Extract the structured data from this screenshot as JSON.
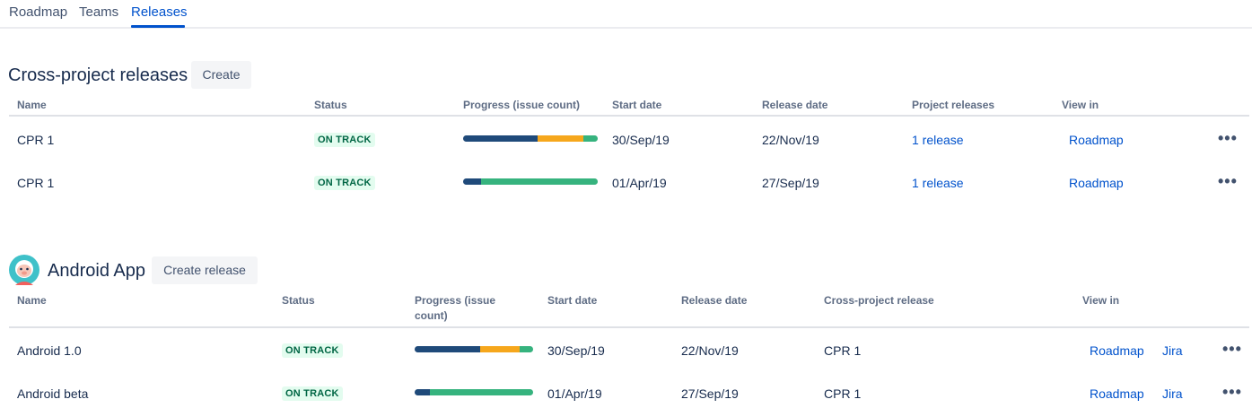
{
  "tabs": [
    {
      "label": "Roadmap",
      "active": false
    },
    {
      "label": "Teams",
      "active": false
    },
    {
      "label": "Releases",
      "active": true
    }
  ],
  "colors": {
    "done": "#1F4A7A",
    "in_progress": "#F6A71C",
    "todo": "#36B37E",
    "link": "#0052CC",
    "lozenge_bg": "#E3FCEF",
    "lozenge_text": "#006644"
  },
  "cross_project": {
    "title": "Cross-project releases",
    "create_label": "Create",
    "columns": {
      "name": "Name",
      "status": "Status",
      "progress": "Progress (issue count)",
      "start_date": "Start date",
      "release_date": "Release date",
      "project_releases": "Project releases",
      "view_in": "View in"
    },
    "rows": [
      {
        "name": "CPR 1",
        "status": "ON TRACK",
        "progress": {
          "done": 0.55,
          "in_progress": 0.34,
          "todo": 0.11
        },
        "start_date": "30/Sep/19",
        "release_date": "22/Nov/19",
        "project_releases": "1 release",
        "view_in": "Roadmap",
        "more_icon": "more-horizontal-icon"
      },
      {
        "name": "CPR 1",
        "status": "ON TRACK",
        "progress": {
          "done": 0.13,
          "in_progress": 0,
          "todo": 0.87
        },
        "start_date": "01/Apr/19",
        "release_date": "27/Sep/19",
        "project_releases": "1 release",
        "view_in": "Roadmap",
        "more_icon": "more-horizontal-icon"
      }
    ]
  },
  "android": {
    "title": "Android App",
    "avatar_icon": "project-avatar-icon",
    "create_label": "Create release",
    "columns": {
      "name": "Name",
      "status": "Status",
      "progress_line1": "Progress (issue",
      "progress_line2": "count)",
      "start_date": "Start date",
      "release_date": "Release date",
      "cross_project_release": "Cross-project release",
      "view_in": "View in"
    },
    "rows": [
      {
        "name": "Android 1.0",
        "status": "ON TRACK",
        "progress": {
          "done": 0.55,
          "in_progress": 0.34,
          "todo": 0.11
        },
        "start_date": "30/Sep/19",
        "release_date": "22/Nov/19",
        "cross_project_release": "CPR 1",
        "view_roadmap": "Roadmap",
        "view_jira": "Jira",
        "more_icon": "more-horizontal-icon"
      },
      {
        "name": "Android beta",
        "status": "ON TRACK",
        "progress": {
          "done": 0.13,
          "in_progress": 0,
          "todo": 0.87
        },
        "start_date": "01/Apr/19",
        "release_date": "27/Sep/19",
        "cross_project_release": "CPR 1",
        "view_roadmap": "Roadmap",
        "view_jira": "Jira",
        "more_icon": "more-horizontal-icon"
      }
    ]
  }
}
